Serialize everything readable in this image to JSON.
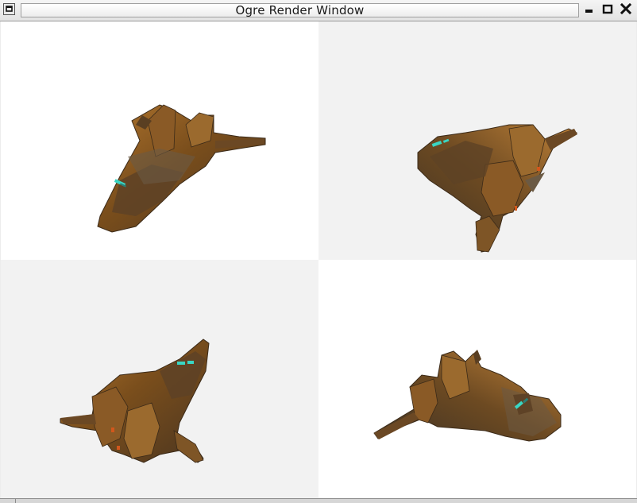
{
  "window": {
    "title": "Ogre Render Window",
    "buttons": [
      "window-menu-icon",
      "minimize-icon",
      "maximize-icon",
      "close-icon"
    ]
  },
  "viewports": [
    {
      "id": "top-left",
      "background": "#ffffff"
    },
    {
      "id": "top-right",
      "background": "#f2f2f2"
    },
    {
      "id": "bottom-left",
      "background": "#f2f2f2"
    },
    {
      "id": "bottom-right",
      "background": "#ffffff"
    }
  ],
  "colors": {
    "ship_body": "#7a4e1c",
    "ship_light": "#b0752e",
    "ship_dark": "#3e3224",
    "engine_glow": "#39d6c4",
    "thruster": "#d2571c"
  }
}
